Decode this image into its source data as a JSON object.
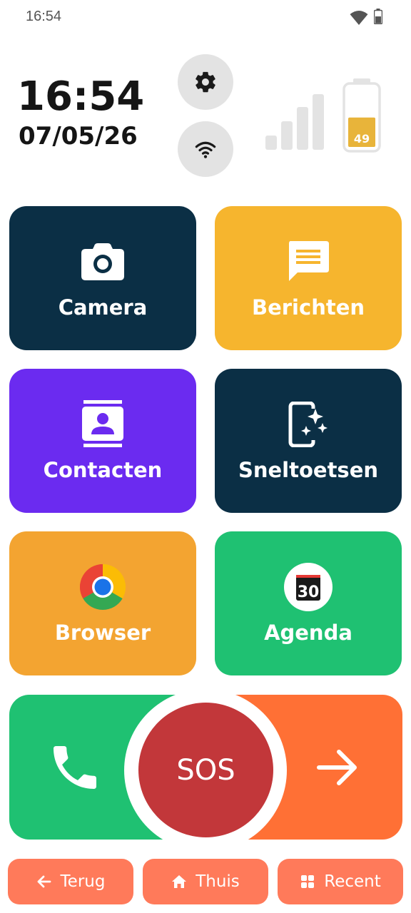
{
  "status_bar": {
    "time": "16:54",
    "icons": [
      "wifi-icon",
      "battery-icon"
    ]
  },
  "header": {
    "clock": "16:54",
    "date": "07/05/26",
    "settings_icon": "gear-icon",
    "wifi_icon": "wifi-icon",
    "signal_icon": "signal-bars-icon",
    "battery_level": "49",
    "battery_fraction": 0.49
  },
  "tiles": [
    {
      "label": "Camera",
      "icon": "camera-icon",
      "color": "#0b2f45"
    },
    {
      "label": "Berichten",
      "icon": "message-icon",
      "color": "#f6b52e"
    },
    {
      "label": "Contacten",
      "icon": "contacts-icon",
      "color": "#6b2bf0"
    },
    {
      "label": "Sneltoetsen",
      "icon": "shortcuts-icon",
      "color": "#0b2f45"
    },
    {
      "label": "Browser",
      "icon": "chrome-icon",
      "color": "#f3a431"
    },
    {
      "label": "Agenda",
      "icon": "calendar-icon",
      "color": "#1fc172"
    }
  ],
  "agenda_day": "30",
  "call_bar": {
    "phone_icon": "phone-icon",
    "sos_label": "SOS",
    "arrow_icon": "arrow-right-icon",
    "left_color": "#1fc172",
    "right_color": "#ff7035",
    "sos_color": "#c2373a"
  },
  "nav": {
    "back_label": "Terug",
    "home_label": "Thuis",
    "recent_label": "Recent"
  }
}
